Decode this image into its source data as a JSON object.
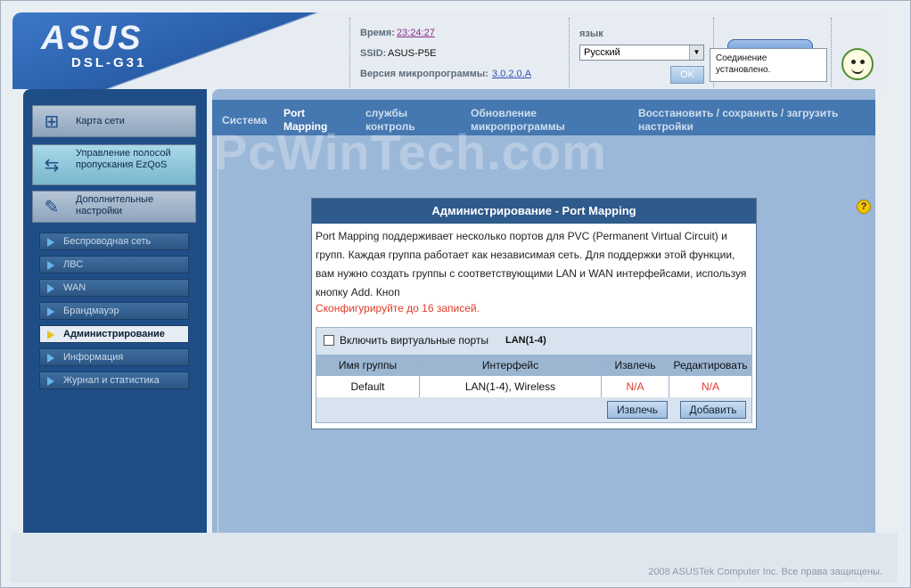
{
  "header": {
    "brand": "ASUS",
    "model": "DSL-G31",
    "time_label": "Время:",
    "time_value": "23:24:27",
    "ssid_label": "SSID:",
    "ssid_value": "ASUS-P5E",
    "fw_label": "Версия микропрограммы:",
    "fw_value": "3.0.2.0.A",
    "lang_label": "язык",
    "lang_value": "Русский",
    "ok_label": "OK",
    "tooltip": "Соединение установлено."
  },
  "sidebar": {
    "big_items": [
      {
        "label": "Карта сети",
        "icon": "network-map-icon"
      },
      {
        "label": "Управление полосой пропускания EzQoS",
        "icon": "qos-icon"
      },
      {
        "label": "Дополнительные настройки",
        "icon": "tools-icon"
      }
    ],
    "sub_items": [
      {
        "label": "Беспроводная сеть"
      },
      {
        "label": "ЛВС"
      },
      {
        "label": "WAN"
      },
      {
        "label": "Брандмауэр"
      },
      {
        "label": "Администрирование"
      },
      {
        "label": "Информация"
      },
      {
        "label": "Журнал и статистика"
      }
    ]
  },
  "tabs": [
    {
      "label": "Система"
    },
    {
      "label": "Port Mapping"
    },
    {
      "label": "службы контроль"
    },
    {
      "label": "Обновление микропрограммы"
    },
    {
      "label": "Восстановить / сохранить / загрузить настройки"
    }
  ],
  "dialog": {
    "title": "Администрирование - Port Mapping",
    "description": "Port Mapping поддерживает несколько портов для PVC (Permanent Virtual Circuit) и групп. Каждая группа работает как независимая сеть. Для поддержки этой функции, вам нужно создать группы с соответствующими LAN и WAN интерфейсами, используя кнопку Add. Кноп",
    "note": "Сконфигурируйте до 16 записей.",
    "checkbox_label": "Включить виртуальные порты",
    "checkbox_port": "LAN(1-4)",
    "table": {
      "headers": [
        "Имя группы",
        "Интерфейс",
        "Извлечь",
        "Редактировать"
      ],
      "rows": [
        [
          "Default",
          "LAN(1-4), Wireless",
          "N/A",
          "N/A"
        ]
      ]
    },
    "remove_label": "Извлечь",
    "add_label": "Добавить"
  },
  "watermark": "PcWinTech.com",
  "footer": {
    "copyright": "2008 ASUSTek Computer Inc. Все права защищены."
  },
  "colors": {
    "accent": "#2f5a8c",
    "sidebar": "#1f4e86",
    "warning_text": "#e03a2a"
  }
}
